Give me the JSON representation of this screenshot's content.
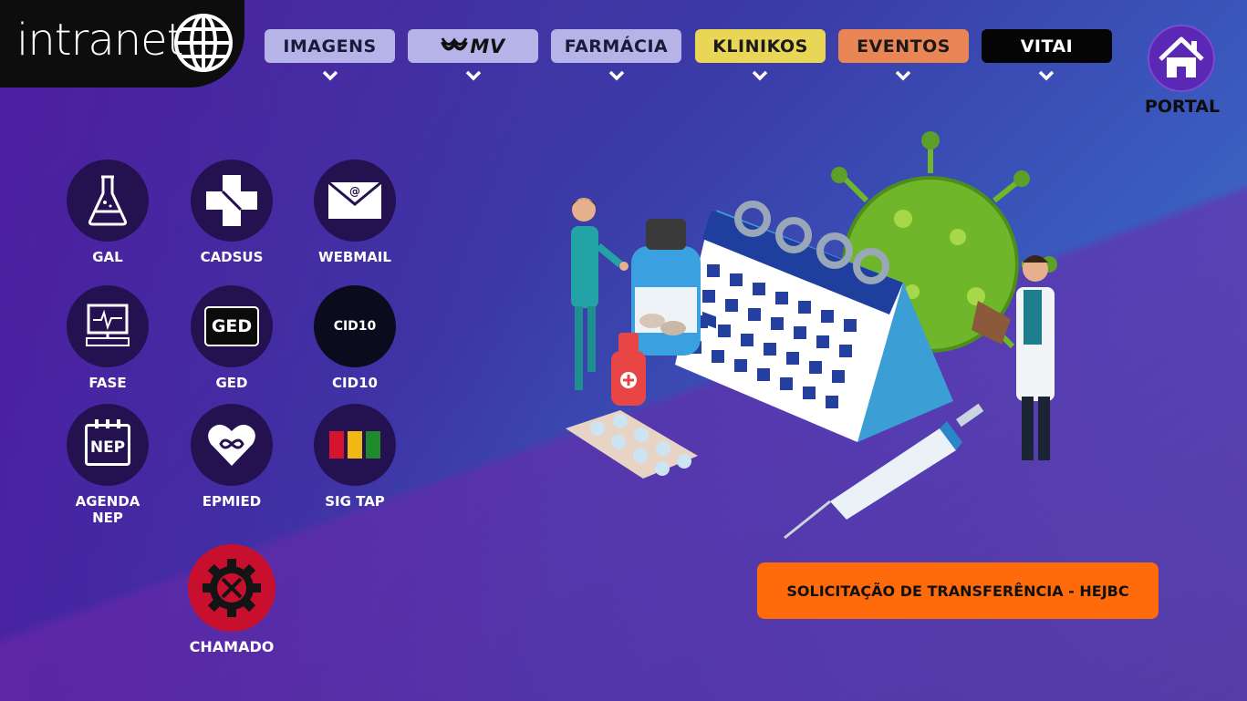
{
  "logo": {
    "text": "intranet"
  },
  "nav": [
    {
      "label": "IMAGENS",
      "bg": "#b6b3e8",
      "fg": "#1a1a3a"
    },
    {
      "label": "MV",
      "bg": "#b6b3e8",
      "fg": "#111111"
    },
    {
      "label": "FARMÁCIA",
      "bg": "#b6b3e8",
      "fg": "#1a1a3a"
    },
    {
      "label": "KLINIKOS",
      "bg": "#e9d556",
      "fg": "#1a1a1a"
    },
    {
      "label": "EVENTOS",
      "bg": "#ea8656",
      "fg": "#1a1a1a"
    },
    {
      "label": "VITAI",
      "bg": "#050505",
      "fg": "#ffffff"
    }
  ],
  "portal": {
    "label": "PORTAL",
    "icon": "home-icon"
  },
  "apps": [
    {
      "label": "GAL",
      "icon": "flask-icon"
    },
    {
      "label": "CADSUS",
      "icon": "cross-icon"
    },
    {
      "label": "WEBMAIL",
      "icon": "mail-icon"
    },
    {
      "label": "FASE",
      "icon": "monitor-icon"
    },
    {
      "label": "GED",
      "icon": "ged-icon",
      "icon_text": "GED"
    },
    {
      "label": "CID10",
      "icon": "cid10-icon",
      "icon_text": "CID10"
    },
    {
      "label": "AGENDA\nNEP",
      "label_line1": "AGENDA",
      "label_line2": "NEP",
      "icon": "calendar-nep-icon",
      "icon_text": "NEP"
    },
    {
      "label": "EPMIED",
      "icon": "heart-infinity-icon"
    },
    {
      "label": "SIG TAP",
      "icon": "color-bars-icon"
    },
    {
      "label": "CHAMADO",
      "icon": "gear-tools-icon"
    }
  ],
  "transfer_button": {
    "label": "SOLICITAÇÃO DE TRANSFERÊNCIA - HEJBC"
  },
  "colors": {
    "accent_orange": "#ff6a0a",
    "icon_circle": "#241150",
    "chamado_red": "#c8102e"
  }
}
